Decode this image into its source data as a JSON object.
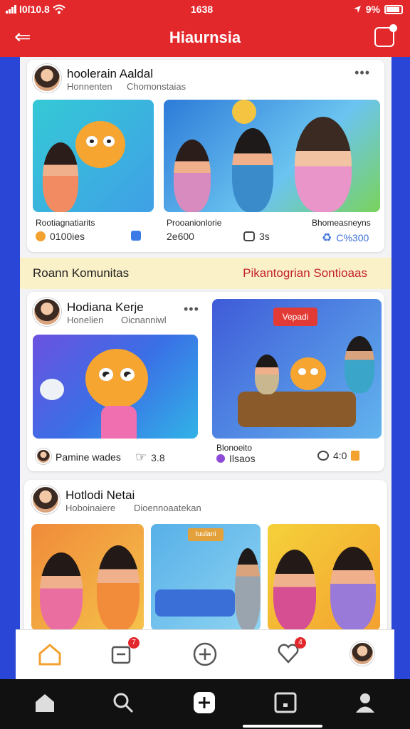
{
  "status": {
    "left_text": "l0ſ10.8",
    "time": "1638",
    "right_text": "9%"
  },
  "header": {
    "title": "Hiaurnsia"
  },
  "posts": [
    {
      "author": "hoolerain Aaldal",
      "subtitle_left": "Honnenten",
      "subtitle_right": "Chomonstaias",
      "media": [
        {
          "caption": "Rootiagnatiarits",
          "stat_label": "0100ies"
        },
        {
          "caption": "Prooanionlorie",
          "stat_value": "2e600",
          "comments": "3s",
          "tag": "Bhomeasneyns",
          "shares": "C%300"
        }
      ]
    },
    {
      "author": "Hodiana Kerje",
      "subtitle_left": "Honelien",
      "subtitle_right": "Oicnanniwl",
      "media": [
        {
          "caption": "Pamine wades",
          "stat_value": "3.8"
        },
        {
          "caption": "Blonoeito",
          "sub_caption": "Ilsaos",
          "stat_value": "4:0",
          "sign": "Vepadi"
        }
      ]
    },
    {
      "author": "Hotlodi Netai",
      "subtitle_left": "Hoboinaiere",
      "subtitle_right": "Dioennoaatekan",
      "media": [
        {
          "sign": "Iuulani"
        }
      ]
    }
  ],
  "banner": {
    "left": "Roann Komunitas",
    "right": "Pikantogrian Sontioaas"
  },
  "bottom_nav": [
    {
      "name": "home",
      "badge": ""
    },
    {
      "name": "messages",
      "badge": "7"
    },
    {
      "name": "create",
      "badge": ""
    },
    {
      "name": "notifications",
      "badge": "4"
    },
    {
      "name": "profile",
      "badge": ""
    }
  ],
  "colors": {
    "brand_red": "#e3282c",
    "side_blue": "#2a46d6",
    "banner_yellow": "#fbf1c8",
    "home_active": "#f3a12f"
  }
}
